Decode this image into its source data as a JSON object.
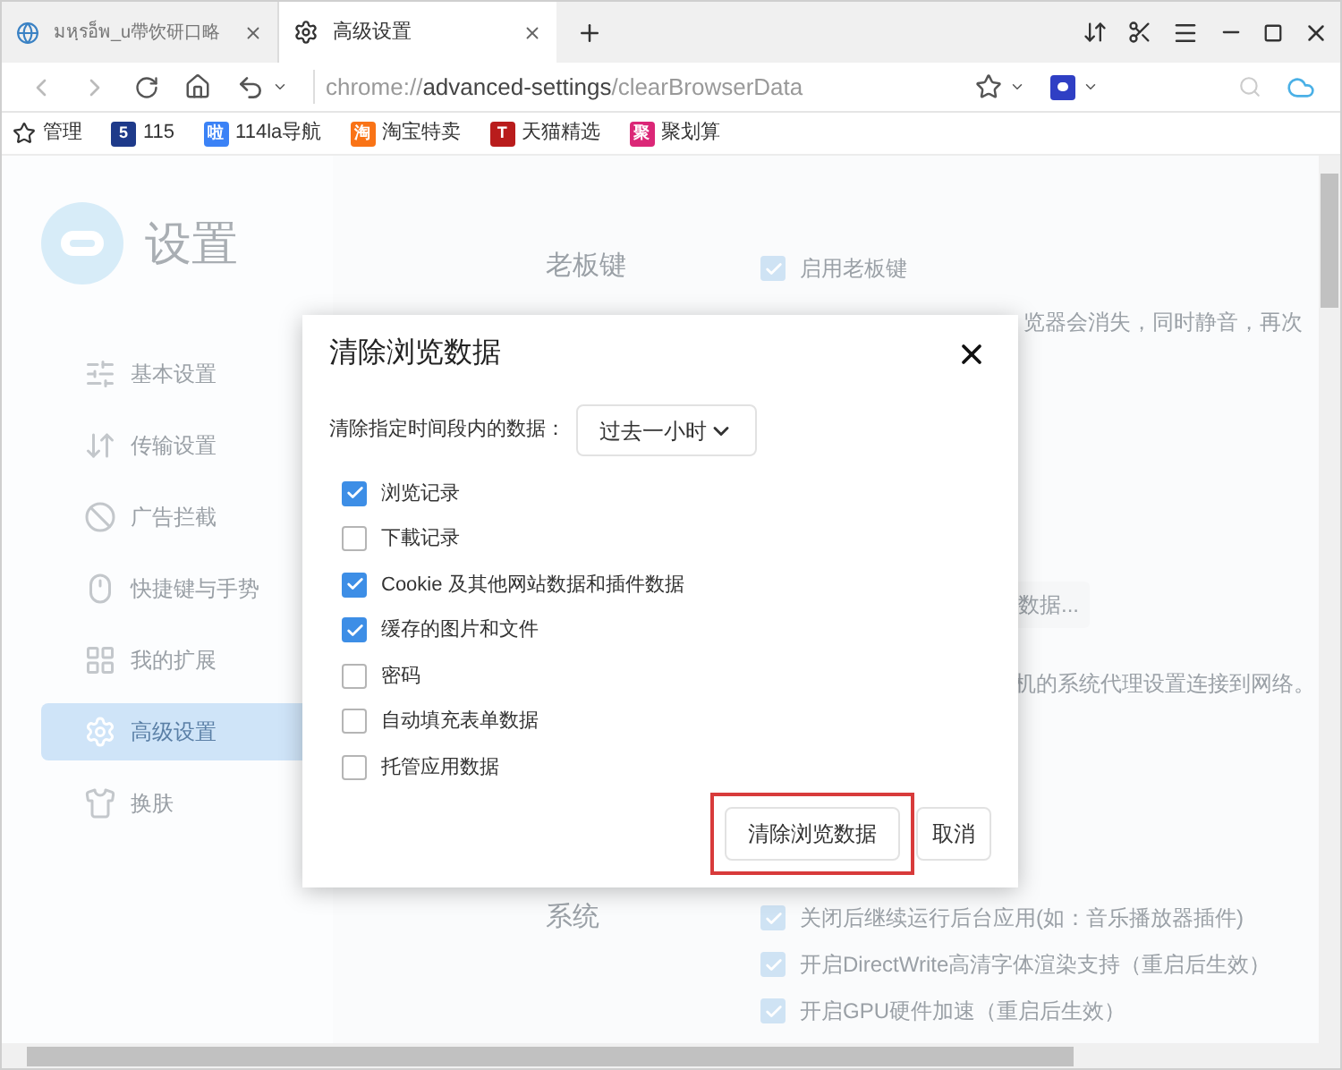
{
  "tabs": [
    {
      "title": "มหฺรอ็พ_u帶饮研口略",
      "kind": "page",
      "selected": false
    },
    {
      "title": "高级设置",
      "kind": "settings",
      "selected": true
    }
  ],
  "address": {
    "scheme": "chrome://",
    "host": "advanced-settings",
    "path": "/clearBrowserData"
  },
  "bookmarks": [
    {
      "label": "管理",
      "kind": "star"
    },
    {
      "label": "115",
      "kind": "badge",
      "badge": "5",
      "color": "#1e3a8a"
    },
    {
      "label": "114la导航",
      "kind": "badge",
      "badge": "啦",
      "color": "#3b82f6"
    },
    {
      "label": "淘宝特卖",
      "kind": "badge",
      "badge": "淘",
      "color": "#f97316"
    },
    {
      "label": "天猫精选",
      "kind": "badge",
      "badge": "T",
      "color": "#b91c1c"
    },
    {
      "label": "聚划算",
      "kind": "badge",
      "badge": "聚",
      "color": "#db2777"
    }
  ],
  "settings": {
    "title": "设置",
    "sidebar": [
      {
        "label": "基本设置",
        "selected": false
      },
      {
        "label": "传输设置",
        "selected": false
      },
      {
        "label": "广告拦截",
        "selected": false
      },
      {
        "label": "快捷键与手势",
        "selected": false
      },
      {
        "label": "我的扩展",
        "selected": false
      },
      {
        "label": "高级设置",
        "selected": true
      },
      {
        "label": "换肤",
        "selected": false
      }
    ],
    "boss_key": {
      "heading": "老板键",
      "option": {
        "label": "启用老板键",
        "checked": true
      },
      "note": "览器会消失，同时静音，再次"
    },
    "clear_button_fragment": "数据...",
    "proxy_note": "机的系统代理设置连接到网络。",
    "system": {
      "heading": "系统",
      "options": [
        {
          "label": "关闭后继续运行后台应用(如：音乐播放器插件)",
          "checked": true
        },
        {
          "label": "开启DirectWrite高清字体渲染支持（重启后生效）",
          "checked": true
        },
        {
          "label": "开启GPU硬件加速（重启后生效）",
          "checked": true
        }
      ]
    }
  },
  "dialog": {
    "title": "清除浏览数据",
    "range_label": "清除指定时间段内的数据：",
    "range_value": "过去一小时",
    "options": [
      {
        "label": "浏览记录",
        "checked": true
      },
      {
        "label": "下載记录",
        "checked": false
      },
      {
        "label": "Cookie 及其他网站数据和插件数据",
        "checked": true
      },
      {
        "label": "缓存的图片和文件",
        "checked": true
      },
      {
        "label": "密码",
        "checked": false
      },
      {
        "label": "自动填充表单数据",
        "checked": false
      },
      {
        "label": "托管应用数据",
        "checked": false
      }
    ],
    "confirm": "清除浏览数据",
    "cancel": "取消",
    "highlighted": true
  }
}
